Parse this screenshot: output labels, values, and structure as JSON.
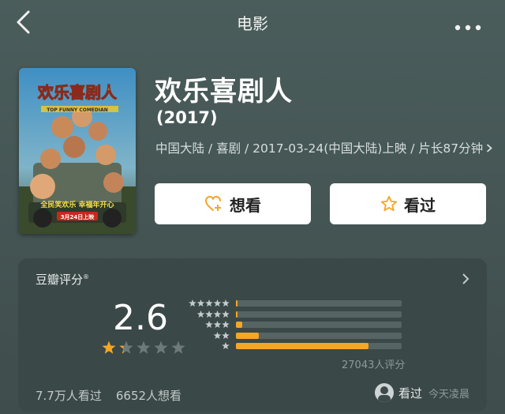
{
  "nav": {
    "title": "电影"
  },
  "movie": {
    "title": "欢乐喜剧人",
    "year": "(2017)",
    "meta": "中国大陆 / 喜剧 / 2017-03-24(中国大陆)上映 / 片长87分钟",
    "poster": {
      "title_cn": "欢乐喜剧人",
      "title_en": "TOP FUNNY COMEDIAN",
      "slogan": "全民笑欢乐 幸福年开心",
      "date": "3月24日上映"
    }
  },
  "actions": {
    "want_label": "想看",
    "seen_label": "看过"
  },
  "rating": {
    "label": "豆瓣评分",
    "mark": "®",
    "score": "2.6",
    "score_value": 2.6,
    "distribution": [
      {
        "stars": 5,
        "fraction": 0.005
      },
      {
        "stars": 4,
        "fraction": 0.005
      },
      {
        "stars": 3,
        "fraction": 0.04
      },
      {
        "stars": 2,
        "fraction": 0.14
      },
      {
        "stars": 1,
        "fraction": 0.8
      }
    ],
    "count": "27043人评分",
    "watched": "7.7万人看过",
    "wants": "6652人想看",
    "user_status": "看过",
    "user_time": "今天凌晨"
  },
  "colors": {
    "accent": "#f5a623",
    "card": "#3a4847",
    "background": "#475857"
  },
  "icons": [
    "back-icon",
    "more-icon",
    "heart-plus-icon",
    "star-outline-icon",
    "chevron-right-icon",
    "star-icon",
    "avatar"
  ]
}
